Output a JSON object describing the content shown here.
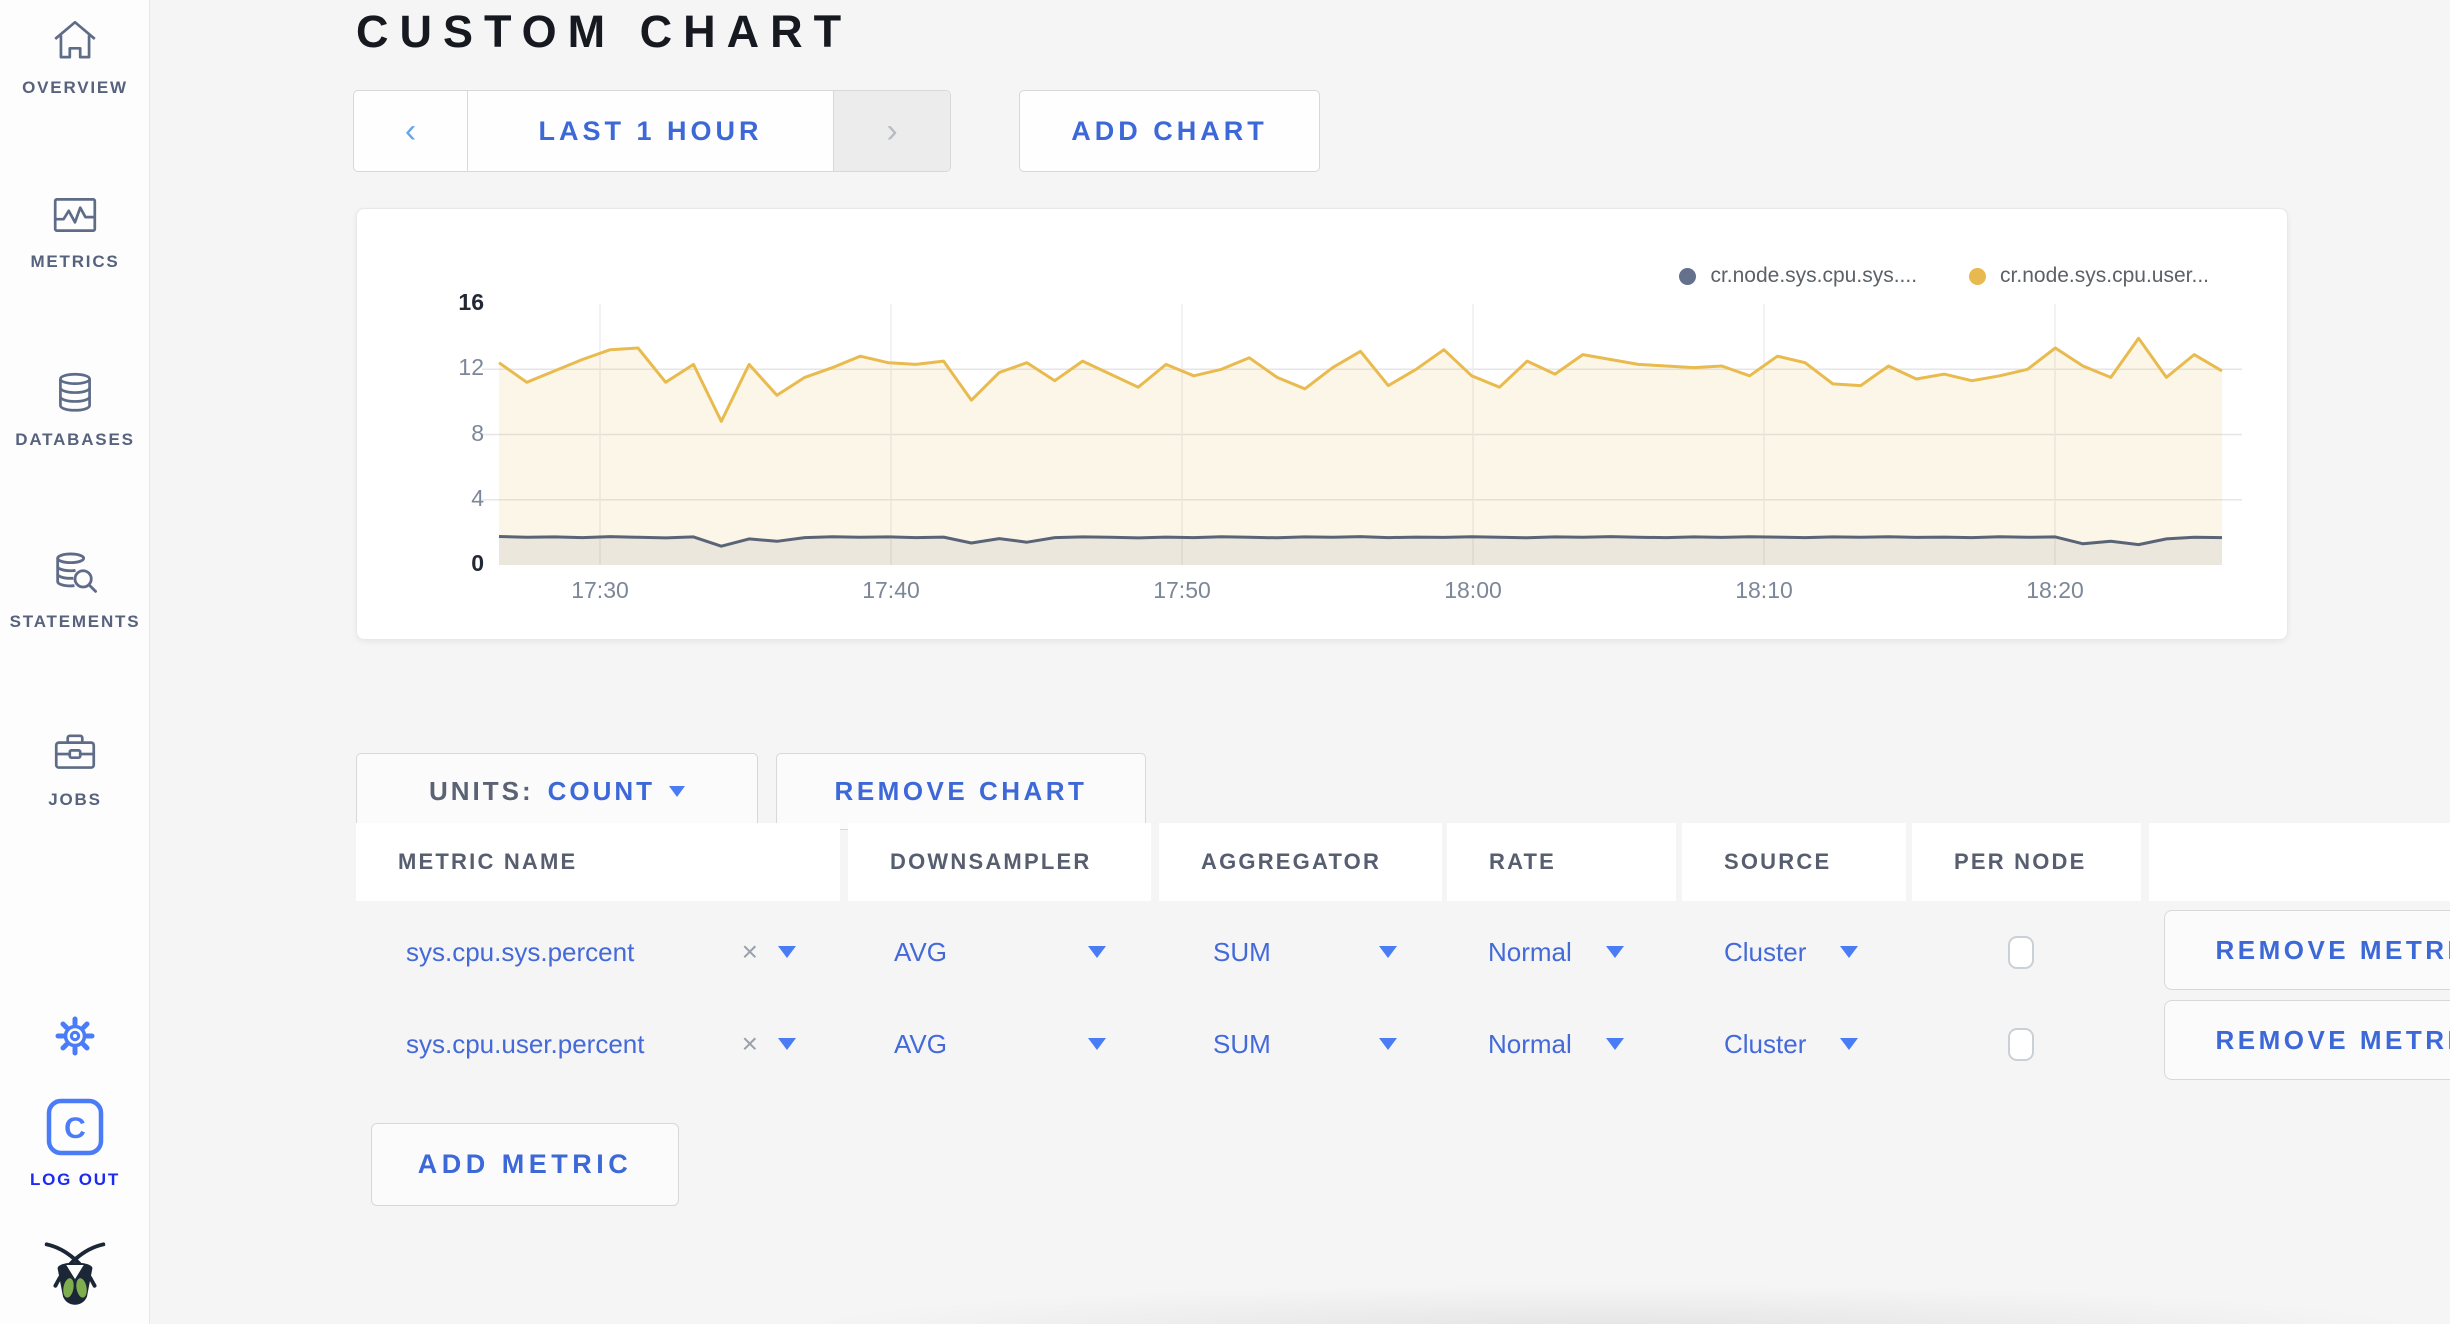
{
  "header": {
    "title": "CUSTOM CHART"
  },
  "toolbar": {
    "prev_arrow": "‹",
    "time_range_label": "LAST 1 HOUR",
    "next_arrow": "›",
    "add_chart_label": "ADD CHART"
  },
  "chart_controls": {
    "units_label": "UNITS:",
    "units_value": "COUNT",
    "remove_chart_label": "REMOVE CHART",
    "add_metric_label": "ADD METRIC"
  },
  "chart_data": {
    "type": "area",
    "title": "",
    "ylim": [
      0,
      16
    ],
    "yticks": [
      0,
      4,
      8,
      12,
      16
    ],
    "xticks": [
      "17:30",
      "17:40",
      "17:50",
      "18:00",
      "18:10",
      "18:20"
    ],
    "grid": true,
    "legend_position": "top-right",
    "legend": [
      {
        "label": "cr.node.sys.cpu.sys....",
        "color": "#64708c"
      },
      {
        "label": "cr.node.sys.cpu.user...",
        "color": "#e7b94f"
      }
    ],
    "series": [
      {
        "name": "cr.node.sys.cpu.sys....",
        "color": "#5a6477",
        "fill": "rgba(90,100,119,0.10)",
        "values": [
          1.75,
          1.7,
          1.72,
          1.68,
          1.74,
          1.7,
          1.66,
          1.72,
          1.15,
          1.6,
          1.45,
          1.68,
          1.73,
          1.7,
          1.72,
          1.68,
          1.71,
          1.35,
          1.62,
          1.4,
          1.68,
          1.72,
          1.7,
          1.66,
          1.71,
          1.68,
          1.73,
          1.7,
          1.67,
          1.72,
          1.7,
          1.74,
          1.68,
          1.71,
          1.69,
          1.73,
          1.7,
          1.67,
          1.72,
          1.7,
          1.74,
          1.7,
          1.68,
          1.72,
          1.69,
          1.73,
          1.71,
          1.68,
          1.72,
          1.7,
          1.73,
          1.69,
          1.71,
          1.68,
          1.73,
          1.7,
          1.72,
          1.3,
          1.45,
          1.25,
          1.6,
          1.7,
          1.68
        ]
      },
      {
        "name": "cr.node.sys.cpu.user...",
        "color": "#e9bb4e",
        "fill": "rgba(233,187,78,0.13)",
        "values": [
          12.4,
          11.2,
          11.9,
          12.6,
          13.2,
          13.3,
          11.2,
          12.3,
          8.8,
          12.3,
          10.4,
          11.5,
          12.1,
          12.8,
          12.4,
          12.3,
          12.5,
          10.1,
          11.8,
          12.4,
          11.3,
          12.5,
          11.7,
          10.9,
          12.3,
          11.6,
          12.0,
          12.7,
          11.5,
          10.8,
          12.1,
          13.1,
          11.0,
          12.0,
          13.2,
          11.6,
          10.9,
          12.5,
          11.7,
          12.9,
          12.6,
          12.3,
          12.2,
          12.1,
          12.2,
          11.6,
          12.8,
          12.4,
          11.1,
          11.0,
          12.2,
          11.4,
          11.7,
          11.3,
          11.6,
          12.0,
          13.3,
          12.2,
          11.5,
          13.9,
          11.5,
          12.9,
          11.9
        ]
      }
    ]
  },
  "table": {
    "columns": [
      "METRIC NAME",
      "DOWNSAMPLER",
      "AGGREGATOR",
      "RATE",
      "SOURCE",
      "PER NODE"
    ],
    "rows": [
      {
        "metric_name": "sys.cpu.sys.percent",
        "clear_icon": "×",
        "downsampler": "AVG",
        "aggregator": "SUM",
        "rate": "Normal",
        "source": "Cluster",
        "per_node_checked": false,
        "remove_label": "REMOVE METRIC"
      },
      {
        "metric_name": "sys.cpu.user.percent",
        "clear_icon": "×",
        "downsampler": "AVG",
        "aggregator": "SUM",
        "rate": "Normal",
        "source": "Cluster",
        "per_node_checked": false,
        "remove_label": "REMOVE METRIC"
      }
    ]
  },
  "sidebar": {
    "items": [
      {
        "label": "OVERVIEW",
        "icon": "home-icon"
      },
      {
        "label": "METRICS",
        "icon": "metrics-chart-icon"
      },
      {
        "label": "DATABASES",
        "icon": "database-icon"
      },
      {
        "label": "STATEMENTS",
        "icon": "database-search-icon"
      },
      {
        "label": "JOBS",
        "icon": "briefcase-icon"
      }
    ],
    "gear_icon": "gear-icon",
    "logout_label": "LOG OUT",
    "logo_letter": "C",
    "brand_icon": "cockroach-bug-icon",
    "accent_blue": "#4a7cf7",
    "logout_blue": "#1d2bf0"
  }
}
